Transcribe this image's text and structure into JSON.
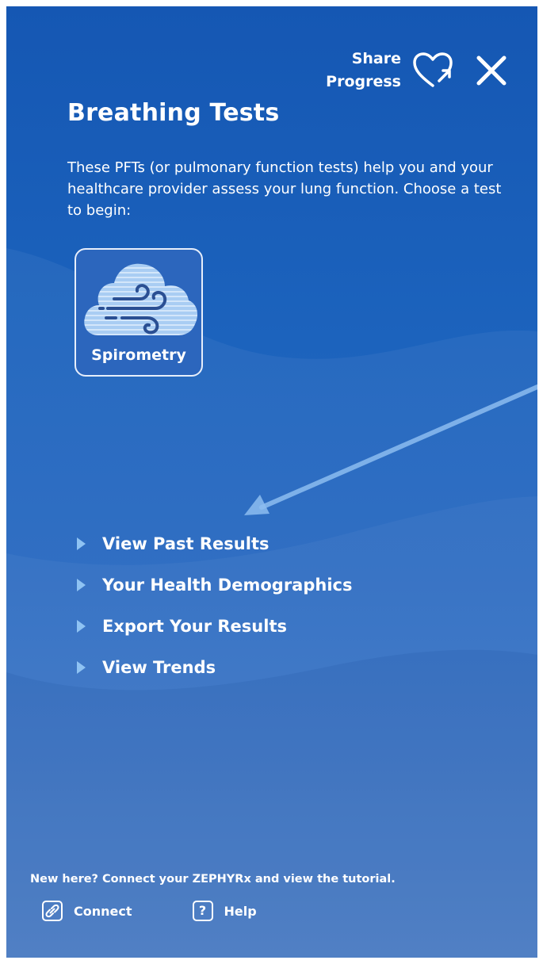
{
  "header": {
    "share_label": "Share\nProgress",
    "share_icon": "heart-share-icon",
    "close_icon": "close-icon"
  },
  "page": {
    "title": "Breathing Tests",
    "intro": "These PFTs (or pulmonary function tests) help you and your healthcare provider assess your lung function. Choose a test to begin:"
  },
  "tests": [
    {
      "label": "Spirometry",
      "icon": "cloud-wind-icon"
    }
  ],
  "menu": {
    "items": [
      {
        "label": "View Past Results",
        "icon": "caret-right-icon"
      },
      {
        "label": "Your Health Demographics",
        "icon": "caret-right-icon"
      },
      {
        "label": "Export Your Results",
        "icon": "caret-right-icon"
      },
      {
        "label": "View Trends",
        "icon": "caret-right-icon"
      }
    ]
  },
  "footer": {
    "note": "New here? Connect your ZEPHYRx and view the tutorial.",
    "connect_label": "Connect",
    "connect_icon": "link-icon",
    "help_label": "Help",
    "help_icon": "question-icon",
    "help_glyph": "?"
  },
  "colors": {
    "background_top": "#1557b3",
    "background_bottom": "#4a7ec7",
    "caret": "#8fc3f3",
    "tile_fill": "#2c66bd",
    "cloud_fill": "#a9cdf3"
  }
}
